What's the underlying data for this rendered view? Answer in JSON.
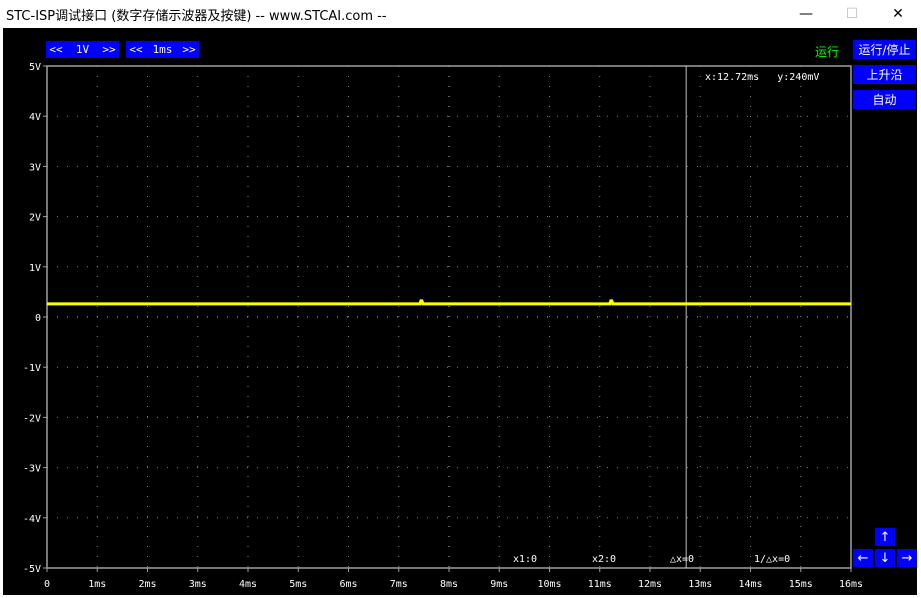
{
  "window": {
    "title": "STC-ISP调试接口 (数字存储示波器及按键) -- www.STCAI.com --",
    "min_glyph": "—",
    "max_glyph": "☐",
    "close_glyph": "✕"
  },
  "toolbar": {
    "volt": {
      "left": "<<",
      "value": "1V",
      "right": ">>"
    },
    "time": {
      "left": "<<",
      "value": "1ms",
      "right": ">>"
    }
  },
  "status": "运行",
  "buttons": {
    "run_stop": "运行/停止",
    "rising": "上升沿",
    "auto": "自动"
  },
  "arrows": {
    "up": "↑",
    "left": "←",
    "down": "↓",
    "right": "→"
  },
  "readout": {
    "cursor": "x:12.72ms   y:240mV"
  },
  "measure": {
    "x1": "x1:0",
    "x2": "x2:0",
    "dx": "△x=0",
    "inv_dx": "1/△x=0"
  },
  "colors": {
    "trace": "#ffff00",
    "grid": "#a0a0a0",
    "button": "#0000ff",
    "status": "#00ff00"
  },
  "chart_data": {
    "type": "line",
    "y_ticks": [
      "5V",
      "4V",
      "3V",
      "2V",
      "1V",
      "0",
      "-1V",
      "-2V",
      "-3V",
      "-4V",
      "-5V"
    ],
    "x_ticks": [
      "0",
      "1ms",
      "2ms",
      "3ms",
      "4ms",
      "5ms",
      "6ms",
      "7ms",
      "8ms",
      "9ms",
      "10ms",
      "11ms",
      "12ms",
      "13ms",
      "14ms",
      "15ms",
      "16ms"
    ],
    "xlim": [
      0,
      16
    ],
    "ylim": [
      -5,
      5
    ],
    "cursor_x_ms": 12.72,
    "series": [
      {
        "color": "#ffff00",
        "x": [
          0,
          7.42,
          7.44,
          7.46,
          7.48,
          11.2,
          11.22,
          11.24,
          11.26,
          16
        ],
        "y": [
          0.26,
          0.26,
          0.32,
          0.32,
          0.26,
          0.26,
          0.32,
          0.32,
          0.26,
          0.26
        ]
      }
    ],
    "grid": true
  }
}
